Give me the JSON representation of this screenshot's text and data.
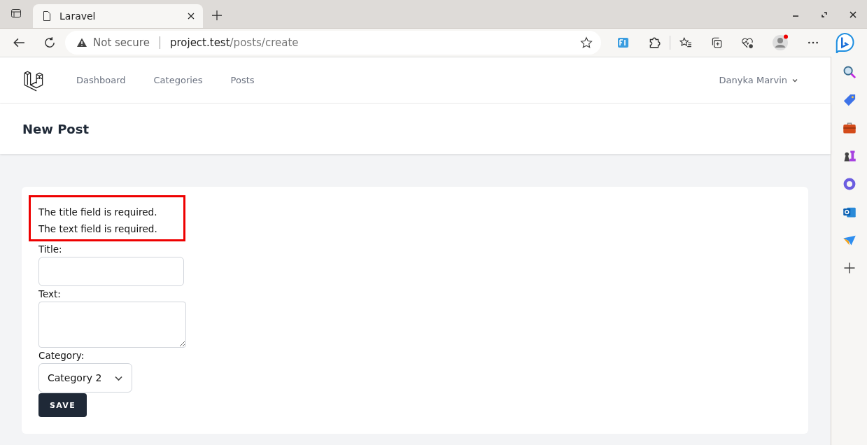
{
  "browser": {
    "tab_title": "Laravel",
    "security": "Not secure",
    "url_host": "project.test",
    "url_path": "/posts/create"
  },
  "nav": {
    "items": [
      "Dashboard",
      "Categories",
      "Posts"
    ],
    "user": "Danyka Marvin"
  },
  "header": {
    "title": "New Post"
  },
  "errors": [
    "The title field is required.",
    "The text field is required."
  ],
  "form": {
    "title_label": "Title:",
    "text_label": "Text:",
    "category_label": "Category:",
    "category_value": "Category 2",
    "submit": "SAVE"
  }
}
